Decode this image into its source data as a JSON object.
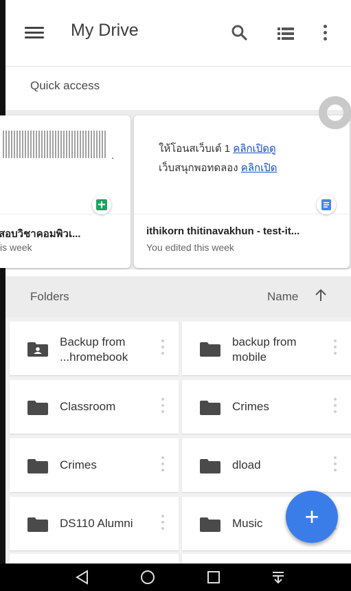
{
  "appbar": {
    "title": "My Drive",
    "menu_icon": "hamburger-menu-icon",
    "search_icon": "search-icon",
    "view_icon": "list-view-icon",
    "more_icon": "more-vert-icon"
  },
  "quick_access": {
    "label": "Quick access",
    "cards": [
      {
        "title": "สอบวิชาคอมพิวเ...",
        "subtitle": "is week",
        "type_icon": "google-sheets-icon"
      },
      {
        "title": "ithikorn thitinavakhun - test-it...",
        "subtitle": "You edited this week",
        "type_icon": "google-docs-icon",
        "preview_line1": "ให้โอนสเว็บเต์ 1 ",
        "preview_link1": "คลิกเปิดดู",
        "preview_line2": "เว็บสนุกพอทดลอง ",
        "preview_link2": "คลิกเปิด"
      }
    ]
  },
  "folders": {
    "label": "Folders",
    "sort_label": "Name",
    "sort_icon": "arrow-up-icon",
    "items": [
      {
        "name": "Backup from\n...hromebook",
        "icon": "shared-folder-icon"
      },
      {
        "name": "backup from\nmobile",
        "icon": "folder-icon"
      },
      {
        "name": "Classroom",
        "icon": "folder-icon"
      },
      {
        "name": "Crimes",
        "icon": "folder-icon"
      },
      {
        "name": "Crimes",
        "icon": "folder-icon"
      },
      {
        "name": "dload",
        "icon": "folder-icon"
      },
      {
        "name": "DS110 Alumni",
        "icon": "folder-icon"
      },
      {
        "name": "Music",
        "icon": "folder-icon"
      }
    ]
  },
  "fab": {
    "label": "+",
    "icon": "add-icon"
  },
  "navbar": {
    "back_icon": "back-triangle-icon",
    "home_icon": "home-circle-icon",
    "recents_icon": "recents-square-icon",
    "notifications_icon": "notification-pull-down-icon"
  },
  "colors": {
    "accent": "#3b7de8",
    "sheets_green": "#1ea362",
    "docs_blue": "#4285f4",
    "link_blue": "#1a4fc1"
  }
}
